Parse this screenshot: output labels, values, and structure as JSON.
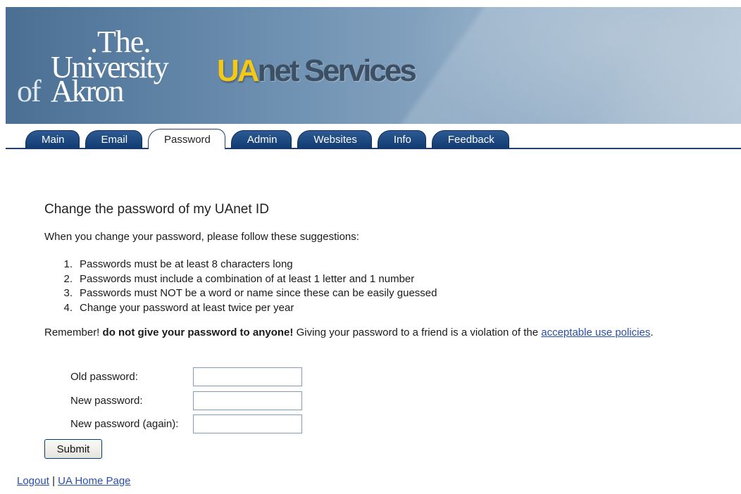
{
  "banner": {
    "logo": {
      "the": ".The.",
      "university": "University",
      "of": "of",
      "akron": "Akron"
    },
    "brand_ua": "UA",
    "brand_rest": "net Services"
  },
  "tabs": [
    {
      "label": "Main",
      "active": false
    },
    {
      "label": "Email",
      "active": false
    },
    {
      "label": "Password",
      "active": true
    },
    {
      "label": "Admin",
      "active": false
    },
    {
      "label": "Websites",
      "active": false
    },
    {
      "label": "Info",
      "active": false
    },
    {
      "label": "Feedback",
      "active": false
    }
  ],
  "main": {
    "title": "Change the password of my UAnet ID",
    "intro": "When you change your password, please follow these suggestions:",
    "rules": [
      {
        "num": "1.",
        "text": "Passwords must be at least 8 characters long"
      },
      {
        "num": "2.",
        "text": "Passwords must include a combination of at least 1 letter and 1 number"
      },
      {
        "num": "3.",
        "text": "Passwords must NOT be a word or name since these can be easily guessed"
      },
      {
        "num": "4.",
        "text": "Change your password at least twice per year"
      }
    ],
    "remember_prefix": "Remember!",
    "remember_bold": "do not give your password to anyone!",
    "remember_mid": "Giving your password to a friend is a violation of the",
    "remember_link": "acceptable use policies",
    "remember_end": "."
  },
  "form": {
    "old_label": "Old password:",
    "new_label": "New password:",
    "again_label": "New password (again):",
    "old_value": "",
    "new_value": "",
    "again_value": "",
    "submit_label": "Submit"
  },
  "footer": {
    "logout": "Logout",
    "separator": "|",
    "home": "UA Home Page"
  },
  "colors": {
    "tab_bg": "#113a72",
    "link": "#2a4fa8",
    "brand_yellow": "#f5c816"
  }
}
